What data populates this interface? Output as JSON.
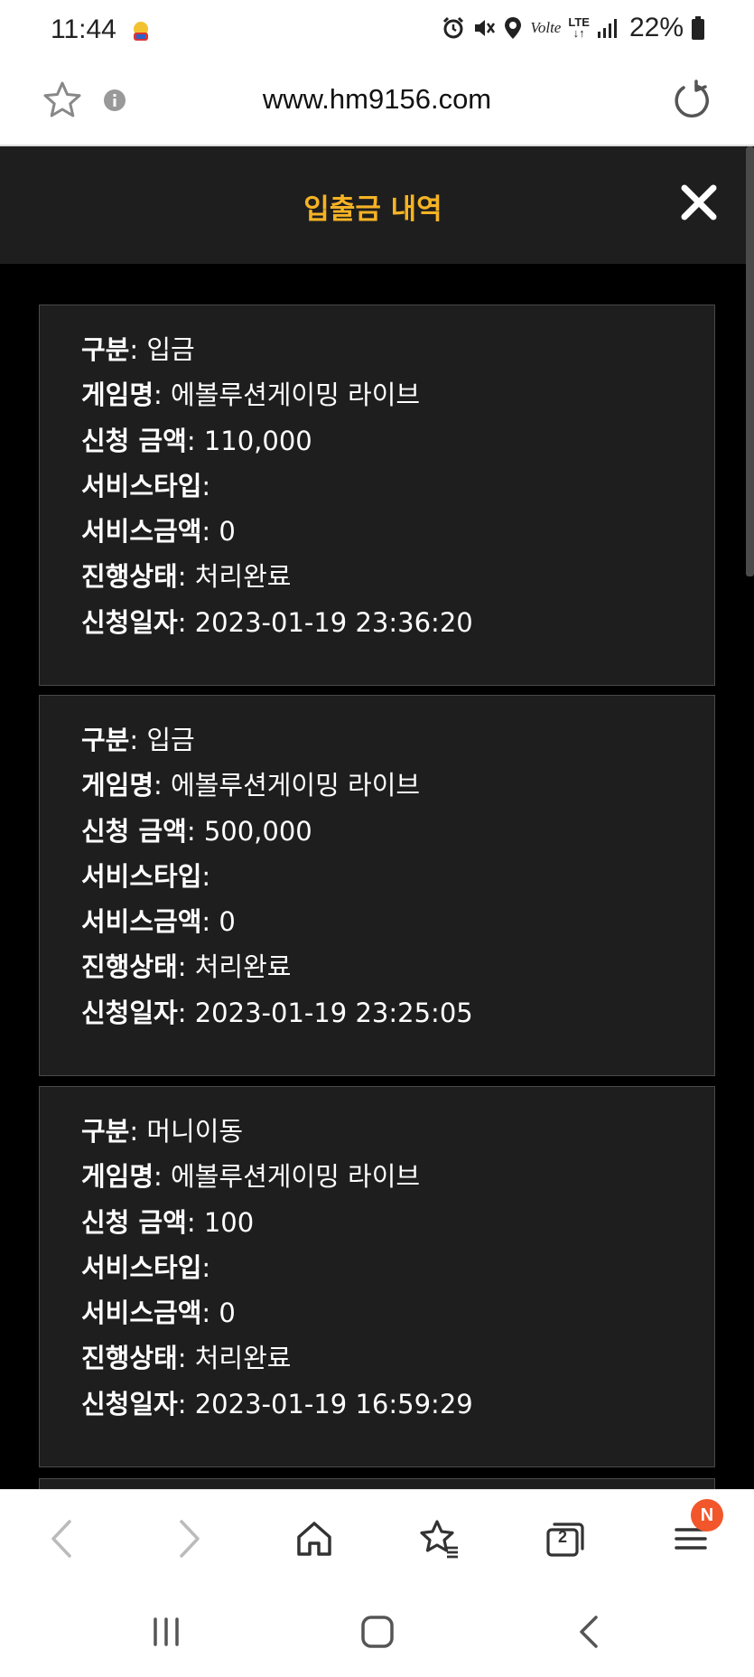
{
  "status_bar": {
    "time": "11:44",
    "network": "LTE",
    "volte": "Volte",
    "battery": "22%"
  },
  "browser": {
    "url": "www.hm9156.com",
    "tab_count": "2",
    "menu_badge": "N"
  },
  "modal": {
    "title": "입출금 내역"
  },
  "labels": {
    "category": "구분",
    "game_name": "게임명",
    "amount": "신청 금액",
    "service_type": "서비스타입",
    "service_amount": "서비스금액",
    "status": "진행상태",
    "date": "신청일자"
  },
  "records": [
    {
      "category": ": 입금",
      "game_name": ": 에볼루션게이밍 라이브",
      "amount": ": 110,000",
      "service_type": ":",
      "service_amount": ": 0",
      "status": ": 처리완료",
      "date": ": 2023-01-19 23:36:20"
    },
    {
      "category": ": 입금",
      "game_name": ": 에볼루션게이밍 라이브",
      "amount": ": 500,000",
      "service_type": ":",
      "service_amount": ": 0",
      "status": ": 처리완료",
      "date": ": 2023-01-19 23:25:05"
    },
    {
      "category": ": 머니이동",
      "game_name": ": 에볼루션게이밍 라이브",
      "amount": ": 100",
      "service_type": ":",
      "service_amount": ": 0",
      "status": ": 처리완료",
      "date": ": 2023-01-19 16:59:29"
    }
  ],
  "colors": {
    "accent": "#f5b324",
    "panel": "#1e1e1e",
    "background": "#000000",
    "badge": "#f2562b"
  }
}
